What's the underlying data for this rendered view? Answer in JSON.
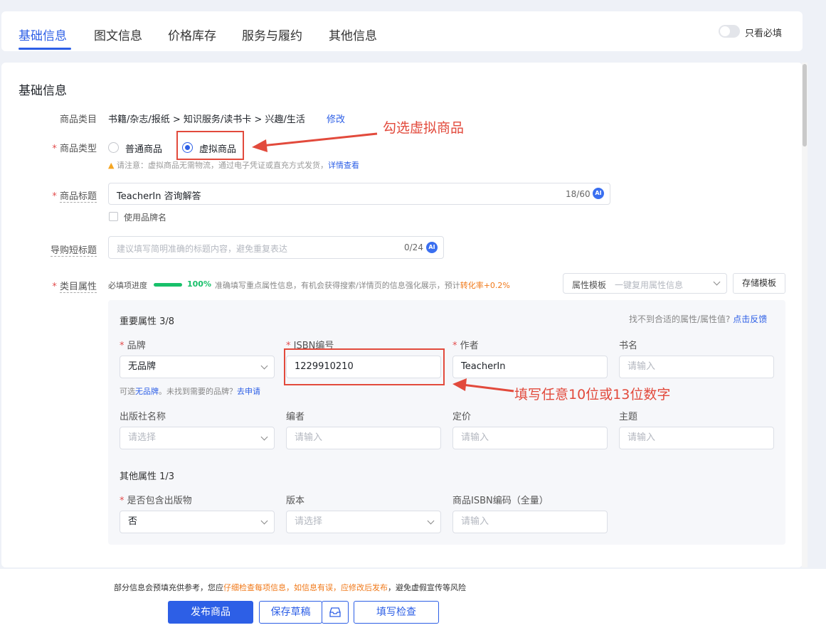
{
  "tabs": [
    {
      "label": "基础信息"
    },
    {
      "label": "图文信息"
    },
    {
      "label": "价格库存"
    },
    {
      "label": "服务与履约"
    },
    {
      "label": "其他信息"
    }
  ],
  "only_required_label": "只看必填",
  "section_title": "基础信息",
  "category": {
    "label": "商品类目",
    "value": "书籍/杂志/报纸 > 知识服务/读书卡 > 兴趣/生活",
    "edit": "修改"
  },
  "product_type": {
    "label": "商品类型",
    "option_normal": "普通商品",
    "option_virtual": "虚拟商品",
    "selected": "虚拟商品",
    "notice": "请注意：虚拟商品无需物流，通过电子凭证或直充方式发货，",
    "notice_link": "详情查看"
  },
  "title_field": {
    "label": "商品标题",
    "value": "TeacherIn 咨询解答",
    "count": "18/60",
    "ai": "AI",
    "brand_checkbox": "使用品牌名"
  },
  "short_title": {
    "label": "导购短标题",
    "placeholder": "建议填写简明准确的标题内容，避免重复表达",
    "count": "0/24",
    "ai": "AI"
  },
  "attributes": {
    "label": "类目属性",
    "progress_label": "必填项进度",
    "progress_value": 1.0,
    "progress_text": "100%",
    "tip": "准确填写重点属性信息，有机会获得搜索/详情页的信息强化展示，预计",
    "tip_highlight": "转化率+0.2%",
    "template_label": "属性模板",
    "template_placeholder": "一键复用属性信息",
    "save_template": "存储模板",
    "important_title": "重要属性 3/8",
    "feedback_question": "找不到合适的属性/属性值?",
    "feedback_link": "点击反馈",
    "brand": {
      "label": "品牌",
      "value": "无品牌",
      "hint_prefix": "可选",
      "hint_link1": "无品牌",
      "hint_mid": "。未找到需要的品牌？",
      "hint_link2": "去申请"
    },
    "isbn": {
      "label": "ISBN编号",
      "value": "1229910210"
    },
    "author": {
      "label": "作者",
      "value": "TeacherIn"
    },
    "book_name": {
      "label": "书名",
      "placeholder": "请输入"
    },
    "publisher": {
      "label": "出版社名称",
      "placeholder": "请选择"
    },
    "editor": {
      "label": "编者",
      "placeholder": "请输入"
    },
    "price": {
      "label": "定价",
      "placeholder": "请输入"
    },
    "theme": {
      "label": "主题",
      "placeholder": "请输入"
    },
    "other_title": "其他属性 1/3",
    "contains_pub": {
      "label": "是否包含出版物",
      "value": "否"
    },
    "edition": {
      "label": "版本",
      "placeholder": "请选择"
    },
    "isbn_code": {
      "label": "商品ISBN编码（全量）",
      "placeholder": "请输入"
    }
  },
  "annotations": {
    "virtual": "勾选虚拟商品",
    "isbn": "填写任意10位或13位数字"
  },
  "footer": {
    "notice_a": "部分信息会预填充供参考，您应",
    "notice_b": "仔细检查每项信息，如信息有误，应修改后发布",
    "notice_c": "，避免虚假宣传等风险",
    "publish": "发布商品",
    "save_draft": "保存草稿",
    "check": "填写检查"
  },
  "colors": {
    "primary": "#2d5fe6",
    "annotation": "#e24a3c",
    "required": "#e34d4d",
    "highlight": "#f07818",
    "progress": "#18c06a"
  }
}
